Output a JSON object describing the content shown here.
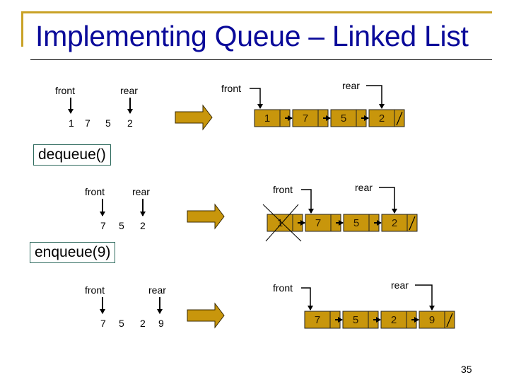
{
  "slide": {
    "title": "Implementing Queue – Linked List",
    "page_number": "35"
  },
  "colors": {
    "title": "#0a0a9a",
    "frame_accent": "#c9a227",
    "node_fill": "#c8960c",
    "arrow_fill": "#c8960c",
    "op_box_border": "#2f6b5e"
  },
  "stages": [
    {
      "abstract": {
        "front_label": "front",
        "rear_label": "rear",
        "values": [
          "1",
          "7",
          "5",
          "2"
        ]
      },
      "linked": {
        "front_label": "front",
        "rear_label": "rear",
        "nodes": [
          "1",
          "7",
          "5",
          "2"
        ],
        "deleted_index": null,
        "front_index": 0,
        "rear_index": 3
      }
    },
    {
      "operation": "dequeue()",
      "abstract": {
        "front_label": "front",
        "rear_label": "rear",
        "values": [
          "7",
          "5",
          "2"
        ]
      },
      "linked": {
        "front_label": "front",
        "rear_label": "rear",
        "nodes": [
          "1",
          "7",
          "5",
          "2"
        ],
        "deleted_index": 0,
        "front_index": 1,
        "rear_index": 3
      }
    },
    {
      "operation": "enqueue(9)",
      "abstract": {
        "front_label": "front",
        "rear_label": "rear",
        "values": [
          "7",
          "5",
          "2",
          "9"
        ]
      },
      "linked": {
        "front_label": "front",
        "rear_label": "rear",
        "nodes": [
          "7",
          "5",
          "2",
          "9"
        ],
        "deleted_index": null,
        "front_index": 0,
        "rear_index": 3
      }
    }
  ]
}
